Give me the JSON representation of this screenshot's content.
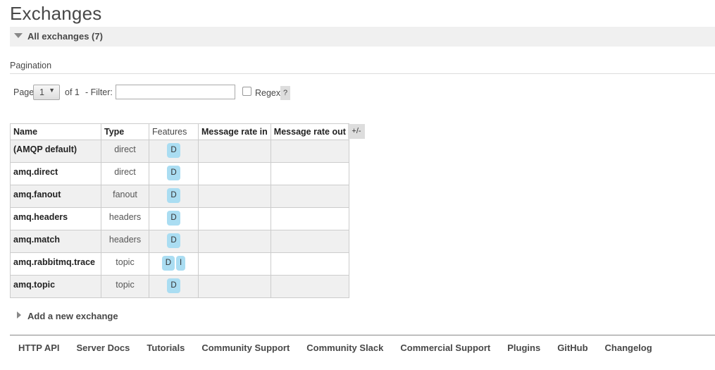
{
  "page": {
    "title": "Exchanges"
  },
  "section": {
    "label": "All exchanges (7)"
  },
  "pagination": {
    "title": "Pagination",
    "page_label": "Page",
    "page_value": "1",
    "of_label": "of 1",
    "filter_label": "- Filter:",
    "filter_value": "",
    "regex_label": "Regex",
    "help_label": "?"
  },
  "table": {
    "headers": [
      "Name",
      "Type",
      "Features",
      "Message rate in",
      "Message rate out"
    ],
    "toggle_label": "+/-",
    "rows": [
      {
        "name": "(AMQP default)",
        "type": "direct",
        "features": [
          "D"
        ]
      },
      {
        "name": "amq.direct",
        "type": "direct",
        "features": [
          "D"
        ]
      },
      {
        "name": "amq.fanout",
        "type": "fanout",
        "features": [
          "D"
        ]
      },
      {
        "name": "amq.headers",
        "type": "headers",
        "features": [
          "D"
        ]
      },
      {
        "name": "amq.match",
        "type": "headers",
        "features": [
          "D"
        ]
      },
      {
        "name": "amq.rabbitmq.trace",
        "type": "topic",
        "features": [
          "D",
          "I"
        ]
      },
      {
        "name": "amq.topic",
        "type": "topic",
        "features": [
          "D"
        ]
      }
    ]
  },
  "add_section": {
    "label": "Add a new exchange"
  },
  "footer": {
    "links": [
      "HTTP API",
      "Server Docs",
      "Tutorials",
      "Community Support",
      "Community Slack",
      "Commercial Support",
      "Plugins",
      "GitHub",
      "Changelog"
    ]
  },
  "colors": {
    "feature_badge": "#aaddf2",
    "odd_row": "#f0f0f0",
    "section_bar": "#f0f0f0"
  }
}
